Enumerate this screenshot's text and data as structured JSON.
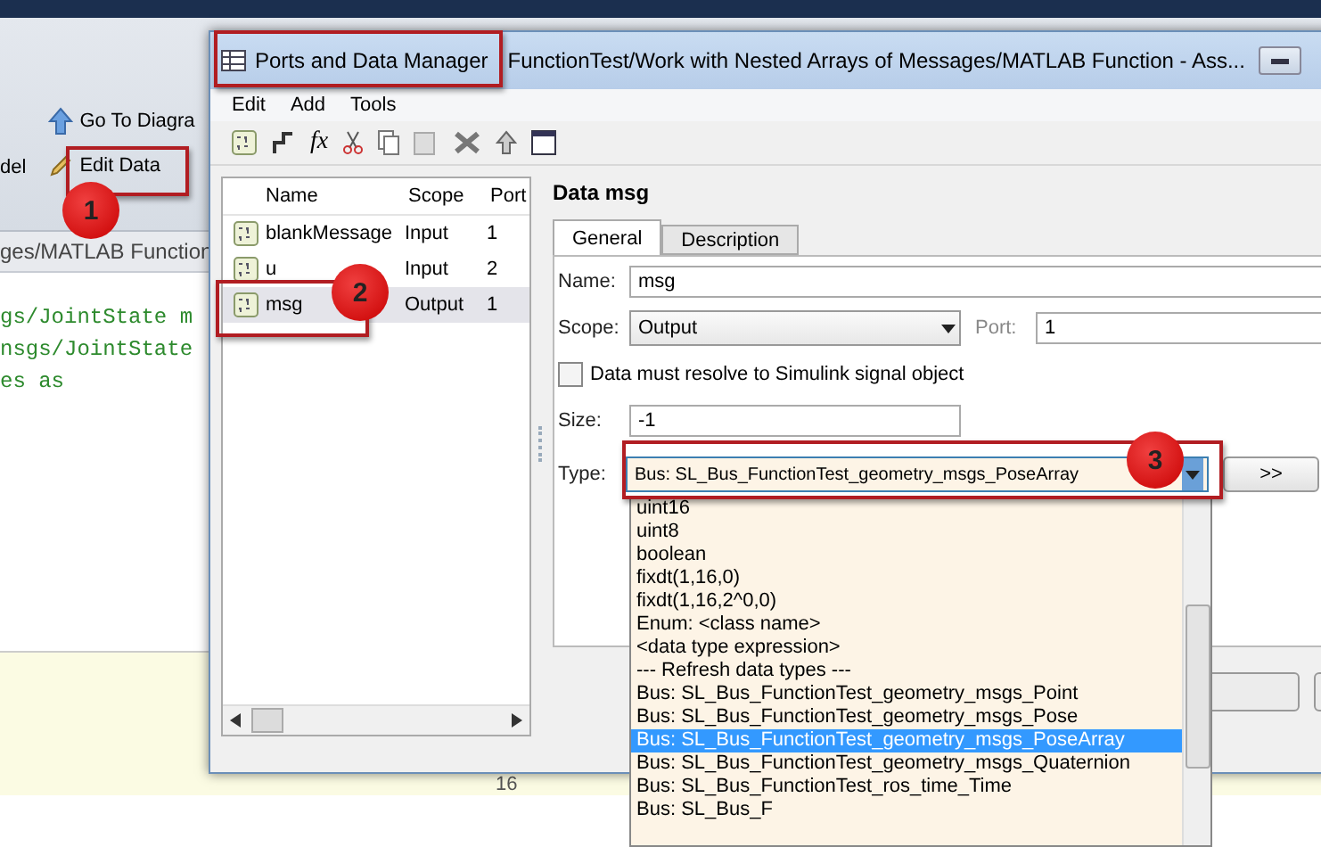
{
  "background_app": {
    "toolbar": {
      "left_label": "del",
      "go_to_diagram": "Go To Diagra",
      "edit_data": "Edit Data"
    },
    "path": "ges/MATLAB Function",
    "code_lines": [
      "gs/JointState m",
      "nsgs/JointState",
      "es as"
    ],
    "line_number": "16"
  },
  "window": {
    "app_name": "Ports and Data Manager",
    "path": "FunctionTest/Work with  Nested Arrays of Messages/MATLAB Function - Ass..."
  },
  "menu": [
    "Edit",
    "Add",
    "Tools"
  ],
  "toolbar": {
    "function_button": "fx"
  },
  "data_list": {
    "columns": [
      "Name",
      "Scope",
      "Port"
    ],
    "rows": [
      {
        "name": "blankMessage",
        "scope": "Input",
        "port": "1",
        "selected": false
      },
      {
        "name": "u",
        "scope": "Input",
        "port": "2",
        "selected": false
      },
      {
        "name": "msg",
        "scope": "Output",
        "port": "1",
        "selected": true
      }
    ]
  },
  "details": {
    "title": "Data msg",
    "tabs": [
      {
        "label": "General",
        "selected": true
      },
      {
        "label": "Description",
        "selected": false
      }
    ],
    "name": {
      "label": "Name:",
      "value": "msg"
    },
    "scope": {
      "label": "Scope:",
      "value": "Output"
    },
    "port": {
      "label": "Port:",
      "value": "1"
    },
    "resolve": {
      "label": "Data must resolve to Simulink signal object",
      "checked": false
    },
    "size": {
      "label": "Size:",
      "value": "-1"
    },
    "type": {
      "label": "Type:",
      "value": "Bus: SL_Bus_FunctionTest_geometry_msgs_PoseArray"
    },
    "more_button": ">>"
  },
  "type_dropdown": [
    {
      "label": "uint16",
      "selected": false
    },
    {
      "label": "uint8",
      "selected": false
    },
    {
      "label": "boolean",
      "selected": false
    },
    {
      "label": "fixdt(1,16,0)",
      "selected": false
    },
    {
      "label": "fixdt(1,16,2^0,0)",
      "selected": false
    },
    {
      "label": "Enum: <class name>",
      "selected": false
    },
    {
      "label": "<data type expression>",
      "selected": false
    },
    {
      "label": "--- Refresh data types ---",
      "selected": false
    },
    {
      "label": "Bus: SL_Bus_FunctionTest_geometry_msgs_Point",
      "selected": false
    },
    {
      "label": "Bus: SL_Bus_FunctionTest_geometry_msgs_Pose",
      "selected": false
    },
    {
      "label": "Bus: SL_Bus_FunctionTest_geometry_msgs_PoseArray",
      "selected": true
    },
    {
      "label": "Bus: SL_Bus_FunctionTest_geometry_msgs_Quaternion",
      "selected": false
    },
    {
      "label": "Bus: SL_Bus_FunctionTest_ros_time_Time",
      "selected": false
    },
    {
      "label": "Bus: SL_Bus_F",
      "selected": false
    }
  ],
  "annotations": [
    "1",
    "2",
    "3"
  ]
}
